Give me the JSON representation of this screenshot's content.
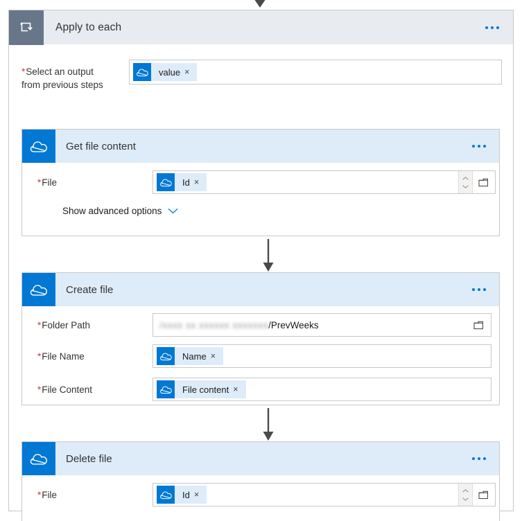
{
  "scope": {
    "title": "Apply to each",
    "icon": "loop-arrow-icon",
    "menu_icon": "ellipsis-icon",
    "input": {
      "label_line1": "Select an output",
      "label_line2": "from previous steps",
      "required_marker": "*",
      "token": {
        "icon": "onedrive-cloud-icon",
        "label": "value",
        "remove": "×"
      }
    }
  },
  "cards": [
    {
      "title": "Get file content",
      "icon": "onedrive-cloud-icon",
      "menu_icon": "ellipsis-icon",
      "fields": [
        {
          "label": "File",
          "required_marker": "*",
          "token": {
            "icon": "onedrive-cloud-icon",
            "label": "Id",
            "remove": "×"
          },
          "has_spinner": true,
          "picker_icon": "folder-picker-icon"
        }
      ],
      "advanced": {
        "label": "Show advanced options",
        "icon": "chevron-down-icon"
      }
    },
    {
      "title": "Create file",
      "icon": "onedrive-cloud-icon",
      "menu_icon": "ellipsis-icon",
      "fields": [
        {
          "label": "Folder Path",
          "required_marker": "*",
          "text_prefix_redacted": "/xxxx xx xxxxxx xxxxxxx",
          "text_visible": "/PrevWeeks",
          "picker_icon": "folder-picker-icon"
        },
        {
          "label": "File Name",
          "required_marker": "*",
          "token": {
            "icon": "onedrive-cloud-icon",
            "label": "Name",
            "remove": "×"
          }
        },
        {
          "label": "File Content",
          "required_marker": "*",
          "token": {
            "icon": "onedrive-cloud-icon",
            "label": "File content",
            "remove": "×"
          }
        }
      ]
    },
    {
      "title": "Delete file",
      "icon": "onedrive-cloud-icon",
      "menu_icon": "ellipsis-icon",
      "fields": [
        {
          "label": "File",
          "required_marker": "*",
          "token": {
            "icon": "onedrive-cloud-icon",
            "label": "Id",
            "remove": "×"
          },
          "has_spinner": true,
          "picker_icon": "folder-picker-icon"
        }
      ]
    }
  ],
  "connectors": [
    {
      "name": "arrow-into-scope"
    },
    {
      "name": "arrow-get-to-create"
    },
    {
      "name": "arrow-create-to-delete"
    }
  ],
  "colors": {
    "accent": "#0078d4",
    "card_header_bg": "#deecf9",
    "scope_header_bg": "#e8ebef",
    "scope_icon_bg": "#68768a",
    "required_red": "#d13438",
    "border": "#c8c8c8",
    "arrow": "#4a4a4a"
  }
}
